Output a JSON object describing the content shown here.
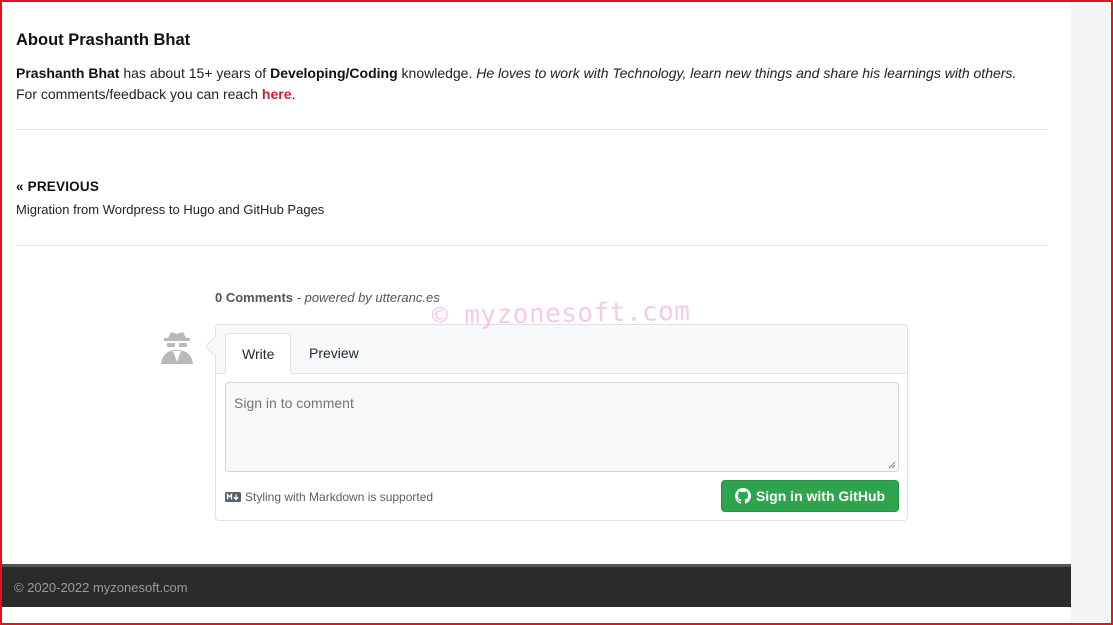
{
  "about": {
    "title": "About Prashanth Bhat",
    "name": "Prashanth Bhat",
    "text1": " has about 15+ years of ",
    "skill": "Developing/Coding",
    "text2": " knowledge. ",
    "tagline": "He loves to work with Technology, learn new things and share his learnings with others.",
    "text3": "For comments/feedback you can reach ",
    "link_label": "here",
    "text4": "."
  },
  "previous": {
    "label": "« PREVIOUS",
    "title": "Migration from Wordpress to Hugo and GitHub Pages"
  },
  "comments": {
    "count_label": "0 Comments",
    "powered_by": " - powered by utteranc.es",
    "watermark": "© myzonesoft.com",
    "tabs": [
      "Write",
      "Preview"
    ],
    "placeholder": "Sign in to comment",
    "markdown_hint": "Styling with Markdown is supported",
    "signin_label": "Sign in with GitHub",
    "avatar_icon": "anonymous-user-icon",
    "markdown_icon": "markdown-icon",
    "github_icon": "github-icon",
    "button_color": "#2ea44f"
  },
  "footer": {
    "copyright": "© 2020-2022 myzonesoft.com"
  }
}
